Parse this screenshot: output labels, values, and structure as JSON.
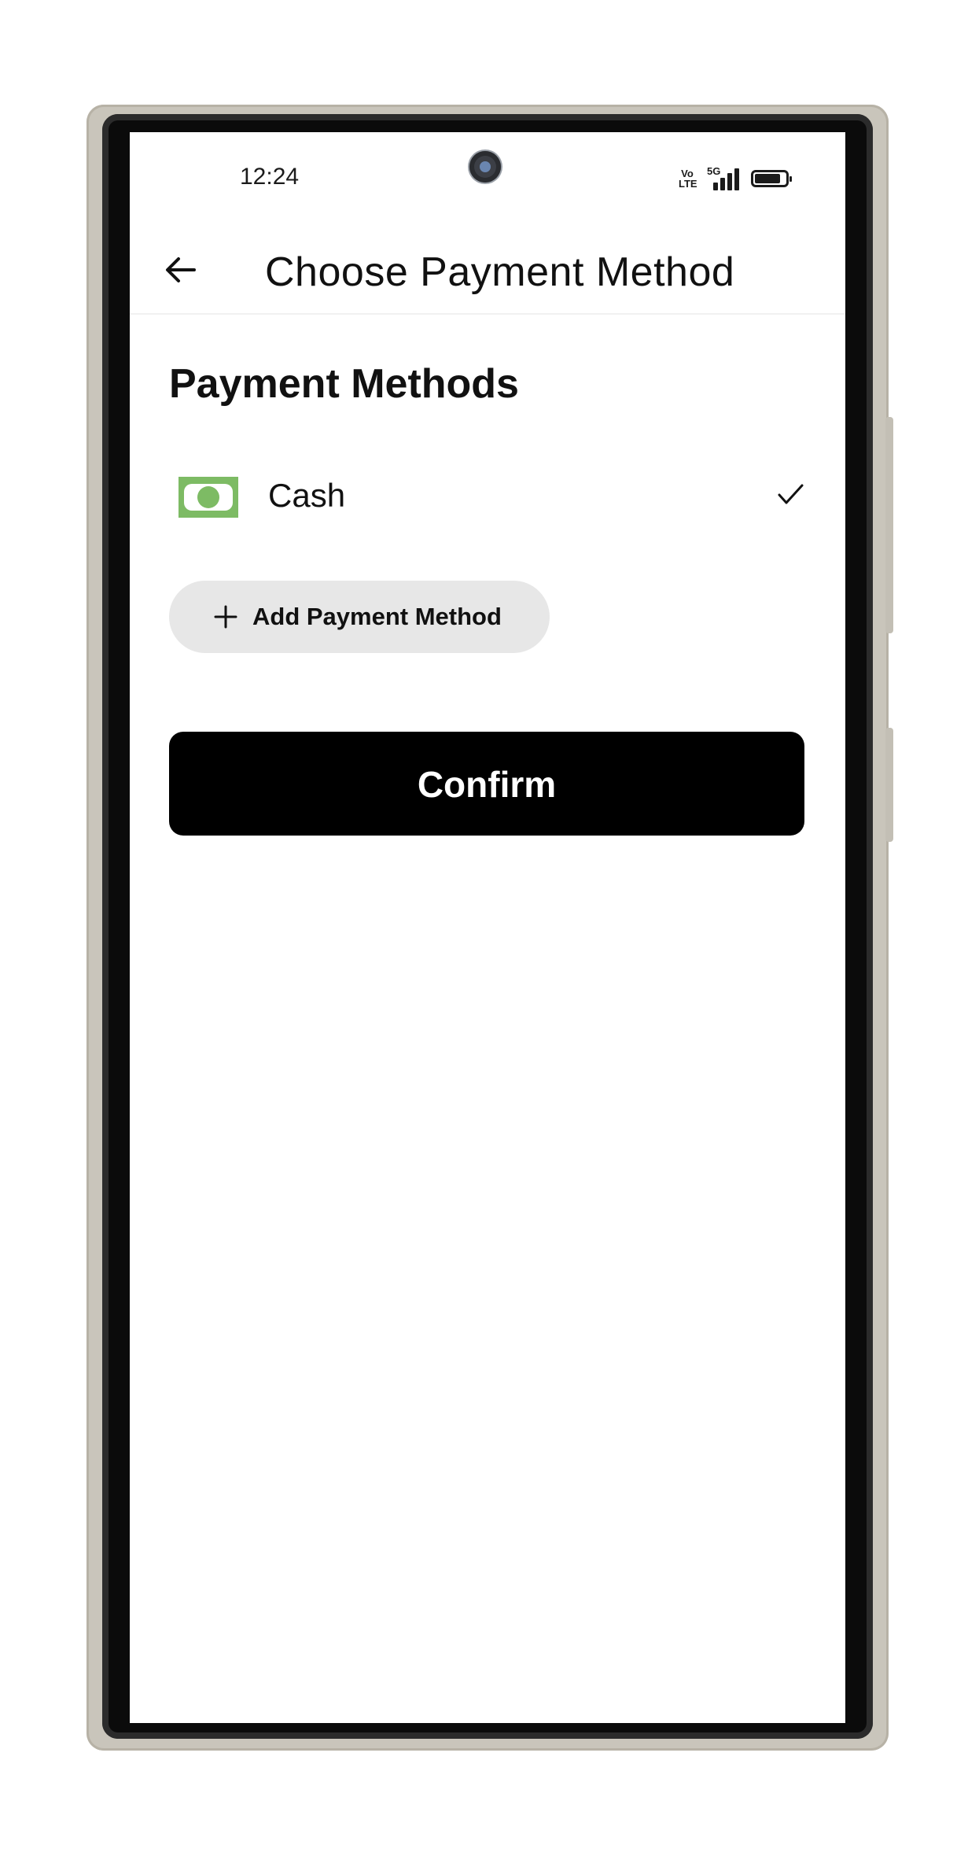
{
  "status_bar": {
    "time": "12:24",
    "volte_top": "Vo",
    "volte_bottom": "LTE",
    "network": "5G",
    "battery_level": 0.85
  },
  "header": {
    "back_icon": "arrow-left-icon",
    "title": "Choose Payment Method"
  },
  "payment_methods": {
    "section_title": "Payment Methods",
    "items": [
      {
        "label": "Cash",
        "icon": "cash-icon",
        "selected": true
      }
    ],
    "add_label": "Add Payment Method"
  },
  "actions": {
    "confirm_label": "Confirm"
  },
  "colors": {
    "cash_green": "#7dbb64",
    "confirm_bg": "#000000",
    "add_bg": "#e7e7e7"
  }
}
